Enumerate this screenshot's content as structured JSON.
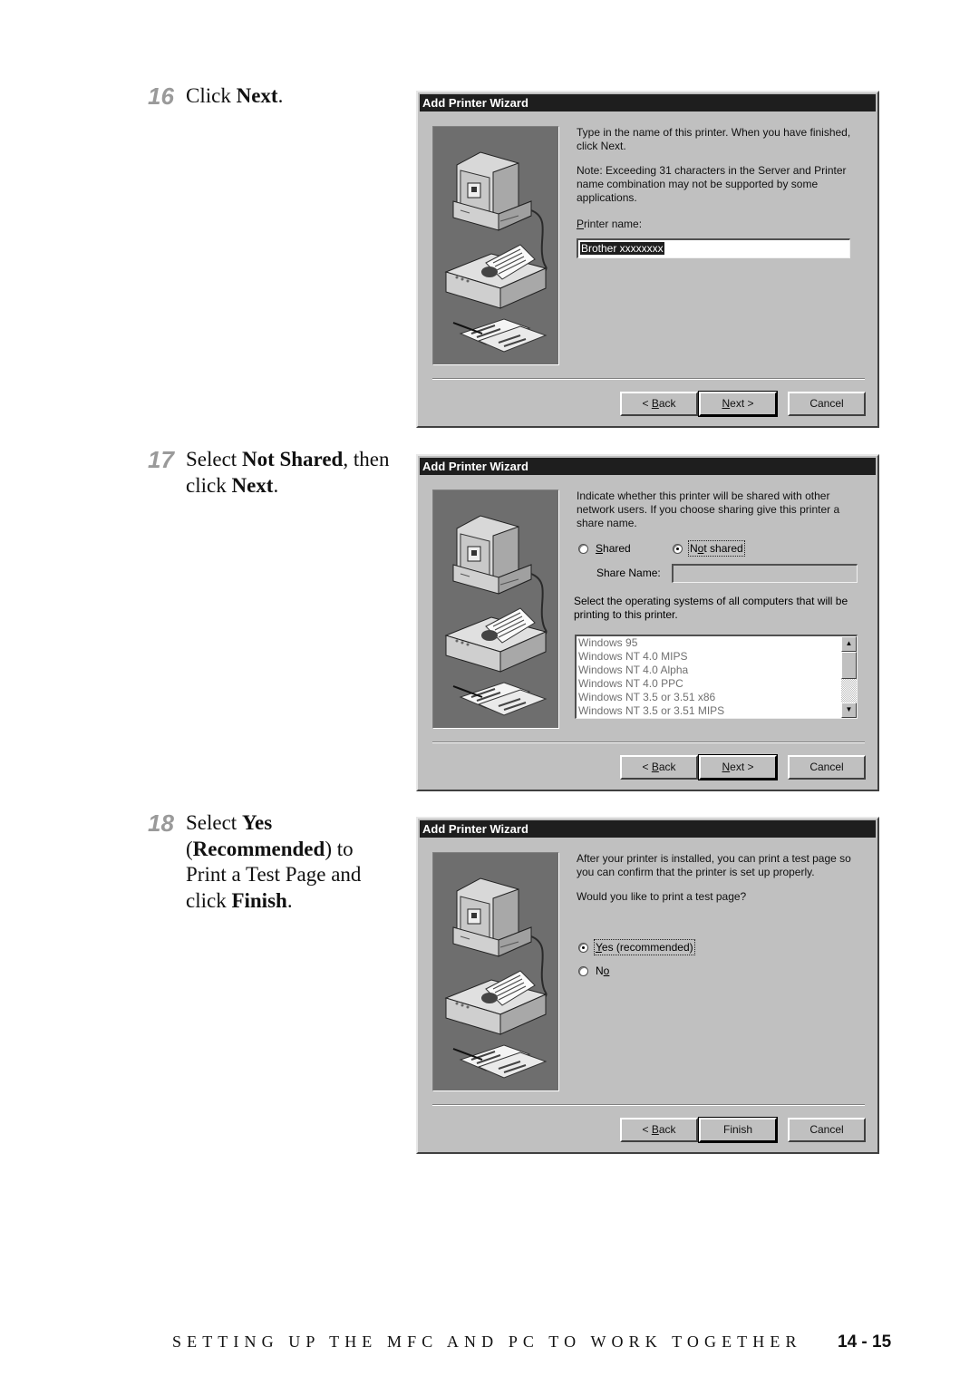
{
  "steps": [
    {
      "number": "16",
      "text_parts": [
        {
          "t": "Click "
        },
        {
          "t": "Next",
          "b": true
        },
        {
          "t": "."
        }
      ]
    },
    {
      "number": "17",
      "text_parts": [
        {
          "t": "Select "
        },
        {
          "t": "Not Shared",
          "b": true
        },
        {
          "t": ", then click "
        },
        {
          "t": "Next",
          "b": true
        },
        {
          "t": "."
        }
      ]
    },
    {
      "number": "18",
      "text_parts": [
        {
          "t": "Select "
        },
        {
          "t": "Yes",
          "b": true
        },
        {
          "t": " ("
        },
        {
          "t": "Recommended",
          "b": true
        },
        {
          "t": ") to Print a Test Page and click "
        },
        {
          "t": "Finish",
          "b": true
        },
        {
          "t": "."
        }
      ]
    }
  ],
  "dialog1": {
    "title": "Add Printer Wizard",
    "intro": "Type in the name of this printer.  When you have finished, click Next.",
    "note": "Note:  Exceeding 31 characters in the Server and Printer name combination may not be supported by some applications.",
    "printer_name_label_accel": "P",
    "printer_name_label_rest": "rinter name:",
    "printer_name_value": "Brother  xxxxxxxx",
    "buttons": {
      "back_prefix": "< ",
      "back_accel": "B",
      "back_rest": "ack",
      "next_accel": "N",
      "next_rest": "ext >",
      "cancel": "Cancel"
    }
  },
  "dialog2": {
    "title": "Add Printer Wizard",
    "intro": "Indicate whether this printer will be shared with other network users.  If you choose sharing give this printer a share name.",
    "shared_accel": "S",
    "shared_rest": "hared",
    "not_shared_pre": "N",
    "not_shared_accel": "o",
    "not_shared_rest": "t shared",
    "selected": "not_shared",
    "share_name_label": "Share Name:",
    "share_name_value": "",
    "os_prompt": "Select the operating systems of all computers that will be printing to this printer.",
    "os_list": [
      "Windows 95",
      "Windows NT 4.0 MIPS",
      "Windows NT 4.0 Alpha",
      "Windows NT 4.0 PPC",
      "Windows NT 3.5 or 3.51 x86",
      "Windows NT 3.5 or 3.51 MIPS"
    ],
    "scroll_up": "▲",
    "scroll_down": "▼",
    "buttons": {
      "back_prefix": "< ",
      "back_accel": "B",
      "back_rest": "ack",
      "next_accel": "N",
      "next_rest": "ext >",
      "cancel": "Cancel"
    }
  },
  "dialog3": {
    "title": "Add Printer Wizard",
    "intro": "After your printer is installed, you can print a test page so you can confirm that the printer is set up properly.",
    "question": "Would you like to print a test page?",
    "yes_accel": "Y",
    "yes_rest": "es (recommended)",
    "no_pre": "N",
    "no_accel": "o",
    "selected": "yes",
    "buttons": {
      "back_prefix": "< ",
      "back_accel": "B",
      "back_rest": "ack",
      "finish": "Finish",
      "cancel": "Cancel"
    }
  },
  "footer": {
    "chapter_title": "SETTING UP THE MFC AND PC TO WORK TOGETHER",
    "page_number": "14 - 15"
  }
}
